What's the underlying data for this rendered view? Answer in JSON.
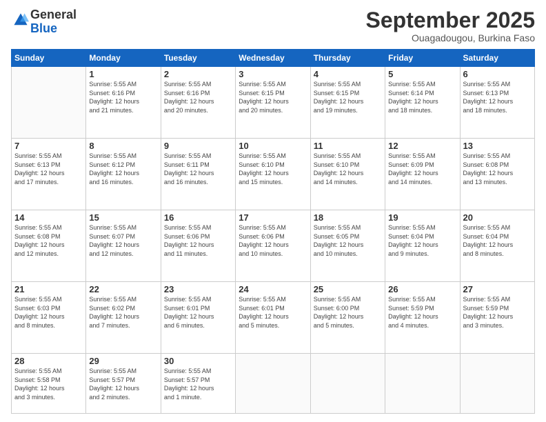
{
  "header": {
    "logo_general": "General",
    "logo_blue": "Blue",
    "month": "September 2025",
    "location": "Ouagadougou, Burkina Faso"
  },
  "weekdays": [
    "Sunday",
    "Monday",
    "Tuesday",
    "Wednesday",
    "Thursday",
    "Friday",
    "Saturday"
  ],
  "weeks": [
    [
      {
        "day": "",
        "info": ""
      },
      {
        "day": "1",
        "info": "Sunrise: 5:55 AM\nSunset: 6:16 PM\nDaylight: 12 hours\nand 21 minutes."
      },
      {
        "day": "2",
        "info": "Sunrise: 5:55 AM\nSunset: 6:16 PM\nDaylight: 12 hours\nand 20 minutes."
      },
      {
        "day": "3",
        "info": "Sunrise: 5:55 AM\nSunset: 6:15 PM\nDaylight: 12 hours\nand 20 minutes."
      },
      {
        "day": "4",
        "info": "Sunrise: 5:55 AM\nSunset: 6:15 PM\nDaylight: 12 hours\nand 19 minutes."
      },
      {
        "day": "5",
        "info": "Sunrise: 5:55 AM\nSunset: 6:14 PM\nDaylight: 12 hours\nand 18 minutes."
      },
      {
        "day": "6",
        "info": "Sunrise: 5:55 AM\nSunset: 6:13 PM\nDaylight: 12 hours\nand 18 minutes."
      }
    ],
    [
      {
        "day": "7",
        "info": "Sunrise: 5:55 AM\nSunset: 6:13 PM\nDaylight: 12 hours\nand 17 minutes."
      },
      {
        "day": "8",
        "info": "Sunrise: 5:55 AM\nSunset: 6:12 PM\nDaylight: 12 hours\nand 16 minutes."
      },
      {
        "day": "9",
        "info": "Sunrise: 5:55 AM\nSunset: 6:11 PM\nDaylight: 12 hours\nand 16 minutes."
      },
      {
        "day": "10",
        "info": "Sunrise: 5:55 AM\nSunset: 6:10 PM\nDaylight: 12 hours\nand 15 minutes."
      },
      {
        "day": "11",
        "info": "Sunrise: 5:55 AM\nSunset: 6:10 PM\nDaylight: 12 hours\nand 14 minutes."
      },
      {
        "day": "12",
        "info": "Sunrise: 5:55 AM\nSunset: 6:09 PM\nDaylight: 12 hours\nand 14 minutes."
      },
      {
        "day": "13",
        "info": "Sunrise: 5:55 AM\nSunset: 6:08 PM\nDaylight: 12 hours\nand 13 minutes."
      }
    ],
    [
      {
        "day": "14",
        "info": "Sunrise: 5:55 AM\nSunset: 6:08 PM\nDaylight: 12 hours\nand 12 minutes."
      },
      {
        "day": "15",
        "info": "Sunrise: 5:55 AM\nSunset: 6:07 PM\nDaylight: 12 hours\nand 12 minutes."
      },
      {
        "day": "16",
        "info": "Sunrise: 5:55 AM\nSunset: 6:06 PM\nDaylight: 12 hours\nand 11 minutes."
      },
      {
        "day": "17",
        "info": "Sunrise: 5:55 AM\nSunset: 6:06 PM\nDaylight: 12 hours\nand 10 minutes."
      },
      {
        "day": "18",
        "info": "Sunrise: 5:55 AM\nSunset: 6:05 PM\nDaylight: 12 hours\nand 10 minutes."
      },
      {
        "day": "19",
        "info": "Sunrise: 5:55 AM\nSunset: 6:04 PM\nDaylight: 12 hours\nand 9 minutes."
      },
      {
        "day": "20",
        "info": "Sunrise: 5:55 AM\nSunset: 6:04 PM\nDaylight: 12 hours\nand 8 minutes."
      }
    ],
    [
      {
        "day": "21",
        "info": "Sunrise: 5:55 AM\nSunset: 6:03 PM\nDaylight: 12 hours\nand 8 minutes."
      },
      {
        "day": "22",
        "info": "Sunrise: 5:55 AM\nSunset: 6:02 PM\nDaylight: 12 hours\nand 7 minutes."
      },
      {
        "day": "23",
        "info": "Sunrise: 5:55 AM\nSunset: 6:01 PM\nDaylight: 12 hours\nand 6 minutes."
      },
      {
        "day": "24",
        "info": "Sunrise: 5:55 AM\nSunset: 6:01 PM\nDaylight: 12 hours\nand 5 minutes."
      },
      {
        "day": "25",
        "info": "Sunrise: 5:55 AM\nSunset: 6:00 PM\nDaylight: 12 hours\nand 5 minutes."
      },
      {
        "day": "26",
        "info": "Sunrise: 5:55 AM\nSunset: 5:59 PM\nDaylight: 12 hours\nand 4 minutes."
      },
      {
        "day": "27",
        "info": "Sunrise: 5:55 AM\nSunset: 5:59 PM\nDaylight: 12 hours\nand 3 minutes."
      }
    ],
    [
      {
        "day": "28",
        "info": "Sunrise: 5:55 AM\nSunset: 5:58 PM\nDaylight: 12 hours\nand 3 minutes."
      },
      {
        "day": "29",
        "info": "Sunrise: 5:55 AM\nSunset: 5:57 PM\nDaylight: 12 hours\nand 2 minutes."
      },
      {
        "day": "30",
        "info": "Sunrise: 5:55 AM\nSunset: 5:57 PM\nDaylight: 12 hours\nand 1 minute."
      },
      {
        "day": "",
        "info": ""
      },
      {
        "day": "",
        "info": ""
      },
      {
        "day": "",
        "info": ""
      },
      {
        "day": "",
        "info": ""
      }
    ]
  ]
}
